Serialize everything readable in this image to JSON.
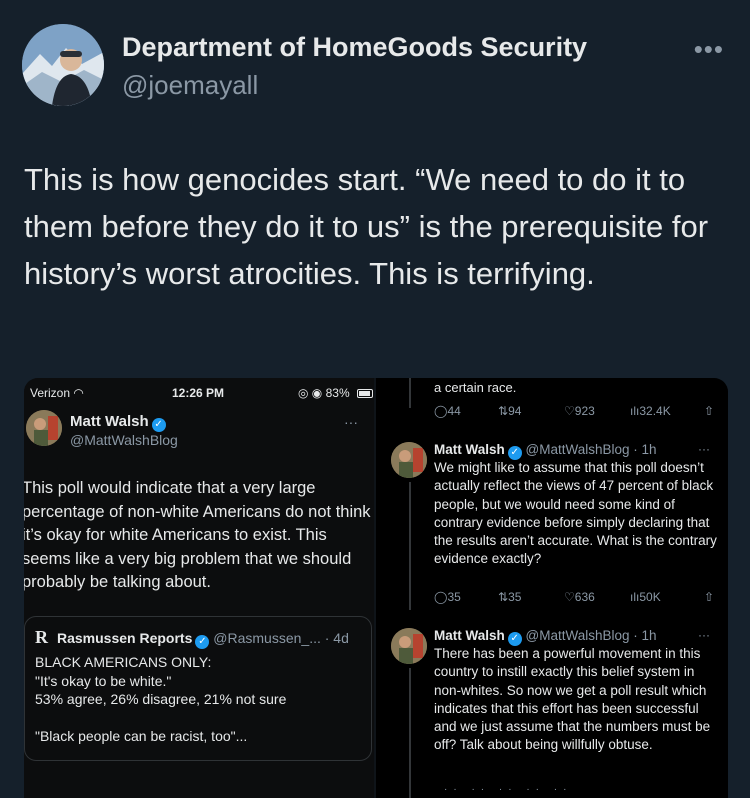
{
  "author": {
    "display_name": "Department of HomeGoods Security",
    "handle": "@joemayall",
    "more_icon": "more-horizontal-icon"
  },
  "tweet": {
    "text": "This is how genocides start. “We need to do it to them before they do it to us” is the prerequisite for history’s worst atrocities. This is terrifying."
  },
  "left_screenshot": {
    "status_bar": {
      "carrier": "Verizon",
      "time": "12:26 PM",
      "battery": "83%"
    },
    "author_name": "Matt Walsh",
    "author_handle": "@MattWalshBlog",
    "more": "···",
    "text": "This poll would indicate that a very large percentage of non-white Americans do not think it’s okay for white Americans to exist. This seems like a very big problem that we should probably be talking about.",
    "quote": {
      "logo": "R",
      "name": "Rasmussen Reports",
      "handle_time": "@Rasmussen_... · 4d",
      "line1": "BLACK AMERICANS ONLY:",
      "line2": "\"It's okay to be white.\"",
      "line3": "53% agree, 26% disagree, 21% not sure",
      "line4": "\"Black people can be racist, too\"..."
    }
  },
  "right_screenshot": {
    "top_text": "a certain race.",
    "top_actions": {
      "replies": "44",
      "reposts": "94",
      "likes": "923",
      "views": "32.4K"
    },
    "reply1": {
      "name": "Matt Walsh",
      "handle_time": "@MattWalshBlog · 1h",
      "text": "We might like to assume that this poll doesn’t actually reflect the views of 47 percent of black people, but we would need some kind of contrary evidence before simply declaring that the results aren’t accurate. What is the contrary evidence exactly?",
      "actions": {
        "replies": "35",
        "reposts": "35",
        "likes": "636",
        "views": "50K"
      }
    },
    "reply2": {
      "name": "Matt Walsh",
      "handle_time": "@MattWalshBlog · 1h",
      "text": "There has been a powerful movement in this country to instill exactly this belief system in non-whites. So now we get a poll result which indicates that this effort has been successful and we just assume that the numbers must be off? Talk about being willfully obtuse."
    }
  },
  "colors": {
    "background": "#15202b",
    "text": "#e7e9ea",
    "secondary": "#8b98a5",
    "verified": "#1d9bf0"
  }
}
